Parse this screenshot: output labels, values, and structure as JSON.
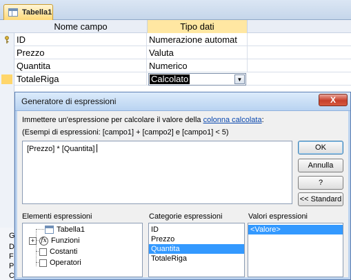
{
  "tab": {
    "label": "Tabella1"
  },
  "grid": {
    "headers": {
      "name": "Nome campo",
      "type": "Tipo dati"
    },
    "rows": [
      {
        "name": "ID",
        "type": "Numerazione automat"
      },
      {
        "name": "Prezzo",
        "type": "Valuta"
      },
      {
        "name": "Quantita",
        "type": "Numerico"
      },
      {
        "name": "TotaleRiga",
        "type": "Calcolato"
      }
    ]
  },
  "left_stub": [
    "G",
    "D",
    "F",
    "P",
    "C"
  ],
  "dialog": {
    "title": "Generatore di espressioni",
    "close_label": "X",
    "instruction_prefix": "Immettere un'espressione per calcolare il valore della",
    "instruction_link": "colonna calcolata",
    "instruction_suffix": ":",
    "example": "(Esempi di espressioni: [campo1] + [campo2] e [campo1] < 5)",
    "expression": "[Prezzo] * [Quantita]",
    "buttons": {
      "ok": "OK",
      "cancel": "Annulla",
      "help": "?",
      "toggle": "<< Standard"
    },
    "elements": {
      "label": "Elementi espressioni",
      "items": [
        "Tabella1",
        "Funzioni",
        "Costanti",
        "Operatori"
      ]
    },
    "categories": {
      "label": "Categorie espressioni",
      "items": [
        "ID",
        "Prezzo",
        "Quantita",
        "TotaleRiga"
      ],
      "selected": "Quantita"
    },
    "values": {
      "label": "Valori espressioni",
      "items": [
        "<Valore>"
      ],
      "selected": "<Valore>"
    }
  }
}
